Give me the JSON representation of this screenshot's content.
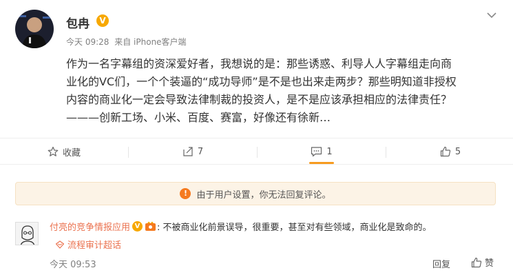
{
  "post": {
    "author": "包冉",
    "verified_mark": "V",
    "time": "今天 09:28",
    "source": "来自 iPhone客户端",
    "content_lines": [
      "作为一名字幕组的资深爱好者，我想说的是：那些诱惑、利导人人字幕组走向商",
      "业化的VC们，一个个装逼的“成功导师”是不是也出来走两步？那些明知道非授权",
      "内容的商业化一定会导致法律制裁的投资人，是不是应该承担相应的法律责任？",
      "———创新工场、小米、百度、赛富，好像还有徐新…"
    ]
  },
  "actions": {
    "favorite_label": "收藏",
    "forward_count": "7",
    "comment_count": "1",
    "like_count": "5"
  },
  "notice": {
    "icon_text": "!",
    "text": "由于用户设置，你无法回复评论。"
  },
  "comment": {
    "user": "付亮的竞争情报应用",
    "verified_mark": "V",
    "text": ": 不被商业化前景误导，很重要，甚至对有些领域，商业化是致命的。",
    "topic": "流程审计超话",
    "time": "今天 09:53",
    "reply_label": "回复",
    "like_label": "赞"
  },
  "colors": {
    "accent": "#eb7350",
    "badge": "#f7a800",
    "notice_bg": "#fcf3e6",
    "notice_icon": "#f57a1f",
    "tab_indicator": "#f79b1f"
  }
}
